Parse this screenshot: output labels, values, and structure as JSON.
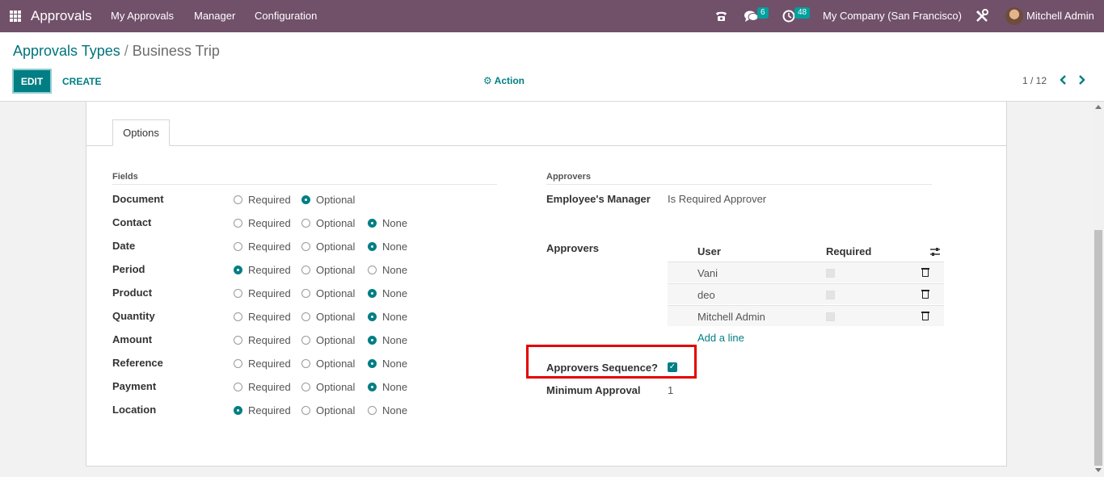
{
  "navbar": {
    "app_name": "Approvals",
    "menus": [
      "My Approvals",
      "Manager",
      "Configuration"
    ],
    "messages_badge": "6",
    "activities_badge": "48",
    "company": "My Company (San Francisco)",
    "user": "Mitchell Admin",
    "color": "#71506a"
  },
  "breadcrumb": {
    "parent": "Approvals Types",
    "separator": "/",
    "current": "Business Trip"
  },
  "buttons": {
    "edit": "EDIT",
    "create": "CREATE",
    "action": "Action"
  },
  "pager": {
    "value": "1 / 12"
  },
  "tabs": [
    "Options"
  ],
  "fields_section": {
    "title": "Fields",
    "option_labels": [
      "Required",
      "Optional",
      "None"
    ],
    "rows": [
      {
        "label": "Document",
        "selected": "Optional",
        "has_none": false
      },
      {
        "label": "Contact",
        "selected": "None",
        "has_none": true
      },
      {
        "label": "Date",
        "selected": "None",
        "has_none": true
      },
      {
        "label": "Period",
        "selected": "Required",
        "has_none": true
      },
      {
        "label": "Product",
        "selected": "None",
        "has_none": true
      },
      {
        "label": "Quantity",
        "selected": "None",
        "has_none": true
      },
      {
        "label": "Amount",
        "selected": "None",
        "has_none": true
      },
      {
        "label": "Reference",
        "selected": "None",
        "has_none": true
      },
      {
        "label": "Payment",
        "selected": "None",
        "has_none": true
      },
      {
        "label": "Location",
        "selected": "Required",
        "has_none": true
      }
    ]
  },
  "approvers_section": {
    "title": "Approvers",
    "employee_manager_label": "Employee's Manager",
    "employee_manager_value": "Is Required Approver",
    "approvers_label": "Approvers",
    "table_headers": {
      "user": "User",
      "required": "Required"
    },
    "approvers": [
      {
        "user": "Vani",
        "required": false
      },
      {
        "user": "deo",
        "required": false
      },
      {
        "user": "Mitchell Admin",
        "required": false
      }
    ],
    "add_line": "Add a line",
    "sequence_label": "Approvers Sequence?",
    "sequence_checked": true,
    "minimum_label": "Minimum Approval",
    "minimum_value": "1"
  },
  "accent_color": "#017e84",
  "highlight_color": "#e30000"
}
